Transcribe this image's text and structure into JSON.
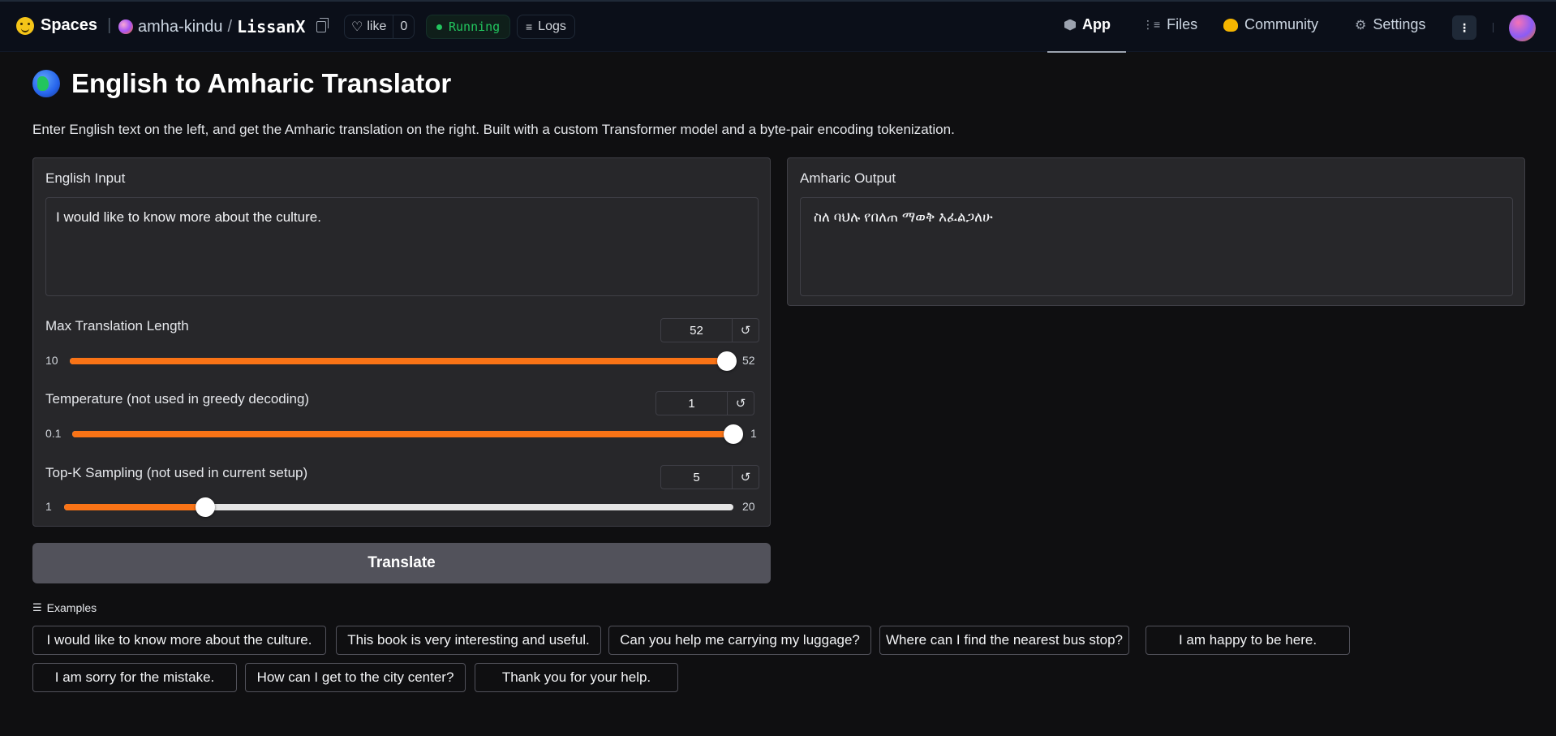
{
  "topbar": {
    "brand": "Spaces",
    "owner": "amha-kindu",
    "repo": "LissanX",
    "like_label": "like",
    "like_count": "0",
    "status": "Running",
    "logs": "Logs",
    "nav": [
      {
        "label": "App",
        "icon": "cube-icon",
        "active": true
      },
      {
        "label": "Files",
        "icon": "files-icon",
        "active": false
      },
      {
        "label": "Community",
        "icon": "hug-icon",
        "active": false
      },
      {
        "label": "Settings",
        "icon": "gear-icon",
        "active": false
      }
    ]
  },
  "app": {
    "title": "English to Amharic Translator",
    "description": "Enter English text on the left, and get the Amharic translation on the right. Built with a custom Transformer model and a byte-pair encoding tokenization."
  },
  "input": {
    "label": "English Input",
    "value": "I would like to know more about the culture."
  },
  "output": {
    "label": "Amharic Output",
    "value": "ስለ ባህሉ የበለጠ ማወቅ እፈልጋለሁ"
  },
  "sliders": [
    {
      "label": "Max Translation Length",
      "value": "52",
      "min": "10",
      "max": "52",
      "fraction": 1.0
    },
    {
      "label": "Temperature (not used in greedy decoding)",
      "value": "1",
      "min": "0.1",
      "max": "1",
      "fraction": 1.0
    },
    {
      "label": "Top-K Sampling (not used in current setup)",
      "value": "5",
      "min": "1",
      "max": "20",
      "fraction": 0.2105
    }
  ],
  "reset_glyph": "↺",
  "translate_button": "Translate",
  "examples": {
    "heading": "Examples",
    "items": [
      "I would like to know more about the culture.",
      "This book is very interesting and useful.",
      "Can you help me carrying my luggage?",
      "Where can I find the nearest bus stop?",
      "I am happy to be here.",
      "I am sorry for the mistake.",
      "How can I get to the city center?",
      "Thank you for your help."
    ]
  },
  "colors": {
    "accent": "#f97316",
    "status_green": "#22c55e",
    "background": "#0f0f11",
    "panel": "#27272a"
  }
}
